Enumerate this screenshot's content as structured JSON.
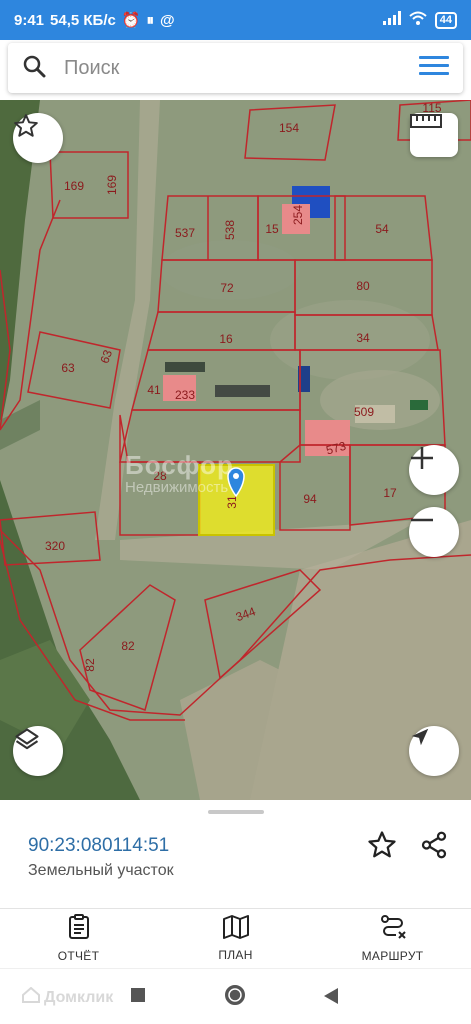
{
  "status_bar": {
    "time": "9:41",
    "speed": "54,5 КБ/с",
    "battery": "44"
  },
  "search": {
    "placeholder": "Поиск"
  },
  "map": {
    "watermark_title": "Босфор",
    "watermark_subtitle": "Недвижимость",
    "parcels": [
      "115",
      "154",
      "169",
      "169",
      "537",
      "538",
      "15",
      "254",
      "54",
      "72",
      "80",
      "16",
      "34",
      "63",
      "63",
      "41",
      "233",
      "509",
      "573",
      "28",
      "31",
      "94",
      "17",
      "320",
      "344",
      "82",
      "82"
    ],
    "colors": {
      "parcel_outline": "#c0262c",
      "selected_fill": "#f2ee1a",
      "building": "#e88a8a",
      "marker": "#2e86de"
    }
  },
  "sheet": {
    "cadastral_number": "90:23:080114:51",
    "object_type": "Земельный участок"
  },
  "tabs": [
    {
      "label": "ОТЧЁТ",
      "icon": "report-icon"
    },
    {
      "label": "ПЛАН",
      "icon": "map-plan-icon"
    },
    {
      "label": "МАРШРУТ",
      "icon": "route-icon"
    }
  ],
  "nav": {
    "brand": "Домклик"
  }
}
